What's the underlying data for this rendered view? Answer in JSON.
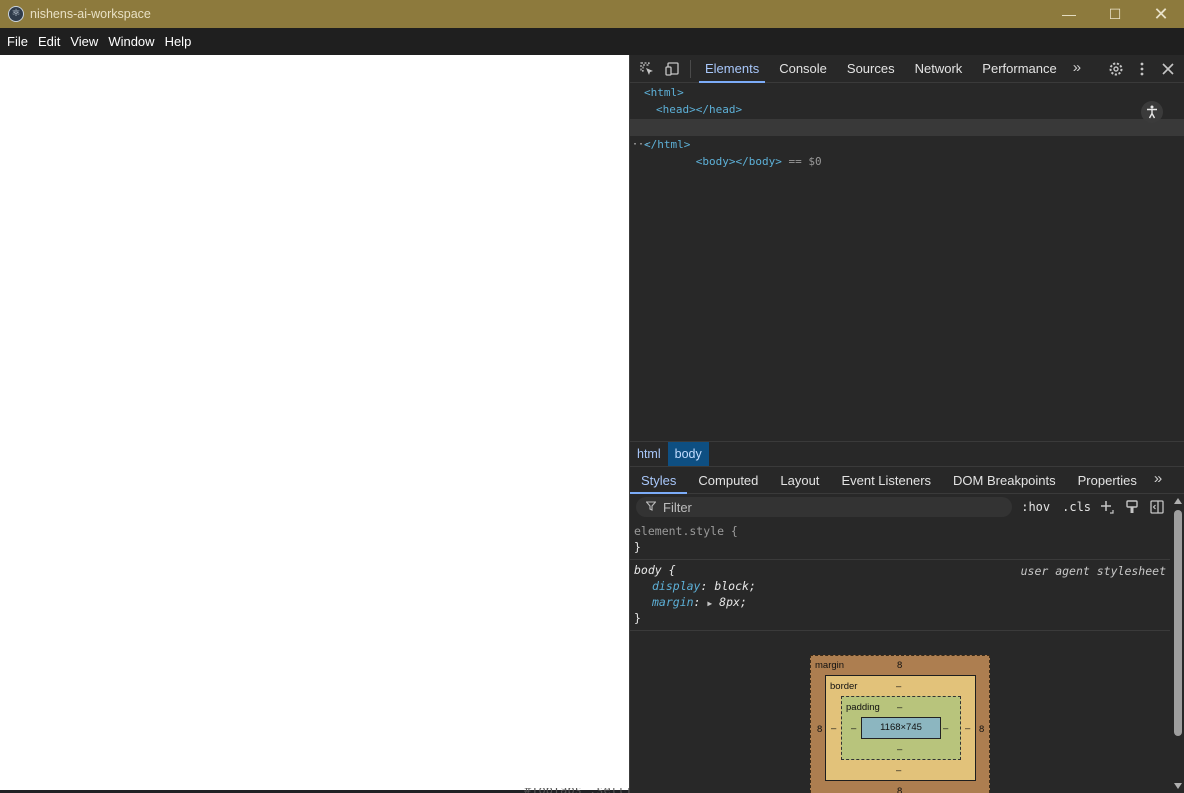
{
  "window": {
    "title": "nishens-ai-workspace",
    "controls": {
      "minimize": "—",
      "maximize": "☐",
      "close": "✕"
    }
  },
  "menu": [
    "File",
    "Edit",
    "View",
    "Window",
    "Help"
  ],
  "devtools": {
    "tabs": [
      "Elements",
      "Console",
      "Sources",
      "Network",
      "Performance"
    ],
    "active_tab": "Elements",
    "more_tabs": "»",
    "dom": {
      "html_open": "<html>",
      "head": "<head></head>",
      "body": "<body></body>",
      "body_suffix": " == $0",
      "html_close": "</html>",
      "dots": "···"
    },
    "breadcrumb": [
      "html",
      "body"
    ],
    "styles_tabs": [
      "Styles",
      "Computed",
      "Layout",
      "Event Listeners",
      "DOM Breakpoints",
      "Properties"
    ],
    "active_styles_tab": "Styles",
    "filter_placeholder": "Filter",
    "hov": ":hov",
    "cls": ".cls",
    "rules": {
      "element_style": {
        "selector": "element.style {",
        "close": "}"
      },
      "body": {
        "selector": "body {",
        "source": "user agent stylesheet",
        "props": [
          {
            "name": "display",
            "value": "block;"
          },
          {
            "name": "margin",
            "value": "8px;"
          }
        ],
        "close": "}"
      }
    },
    "box_model": {
      "margin_label": "margin",
      "margin_top": "8",
      "margin_left": "8",
      "margin_right": "8",
      "margin_bottom": "8",
      "border_label": "border",
      "border_value": "–",
      "padding_label": "padding",
      "padding_value": "–",
      "content_size": "1168×745"
    }
  },
  "underlay_text": "#TopTabs .setting .setting-image-b"
}
